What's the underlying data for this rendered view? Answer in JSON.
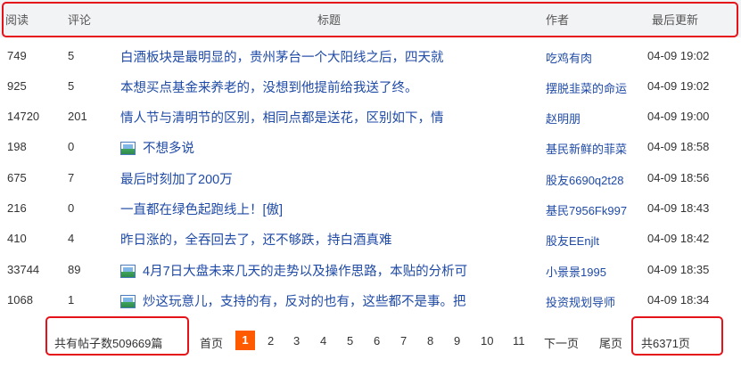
{
  "header": {
    "read": "阅读",
    "comment": "评论",
    "title": "标题",
    "author": "作者",
    "updated": "最后更新"
  },
  "rows": [
    {
      "read": "749",
      "comment": "5",
      "title": "白酒板块是最明显的，贵州茅台一个大阳线之后，四天就",
      "author": "吃鸡有肉",
      "time": "04-09 19:02",
      "has_image": false
    },
    {
      "read": "925",
      "comment": "5",
      "title": "本想买点基金来养老的，没想到他提前给我送了终。",
      "author": "摆脱韭菜的命运",
      "time": "04-09 19:02",
      "has_image": false
    },
    {
      "read": "14720",
      "comment": "201",
      "title": "情人节与清明节的区别，相同点都是送花，区别如下，情",
      "author": "赵明朋",
      "time": "04-09 19:00",
      "has_image": false
    },
    {
      "read": "198",
      "comment": "0",
      "title": "不想多说",
      "author": "基民新鲜的菲菜",
      "time": "04-09 18:58",
      "has_image": true
    },
    {
      "read": "675",
      "comment": "7",
      "title": "最后时刻加了200万",
      "author": "股友6690q2t28",
      "time": "04-09 18:56",
      "has_image": false
    },
    {
      "read": "216",
      "comment": "0",
      "title": "一直都在绿色起跑线上！[傲]",
      "author": "基民7956Fk997",
      "time": "04-09 18:43",
      "has_image": false
    },
    {
      "read": "410",
      "comment": "4",
      "title": "昨日涨的，全吞回去了，还不够跌，持白酒真难",
      "author": "股友EEnjlt",
      "time": "04-09 18:42",
      "has_image": false
    },
    {
      "read": "33744",
      "comment": "89",
      "title": "4月7日大盘未来几天的走势以及操作思路，本贴的分析可",
      "author": "小景景1995",
      "time": "04-09 18:35",
      "has_image": true
    },
    {
      "read": "1068",
      "comment": "1",
      "title": "炒这玩意儿，支持的有，反对的也有，这些都不是事。把",
      "author": "投资规划导师",
      "time": "04-09 18:34",
      "has_image": true
    }
  ],
  "footer": {
    "total_posts": "共有帖子数509669篇",
    "first": "首页",
    "pages": [
      "1",
      "2",
      "3",
      "4",
      "5",
      "6",
      "7",
      "8",
      "9",
      "10",
      "11"
    ],
    "current_page": "1",
    "next": "下一页",
    "last": "尾页",
    "total_pages": "共6371页"
  },
  "colors": {
    "header_bg": "#f2f3f5",
    "link": "#1f4aa6",
    "active_page": "#ff5a00",
    "highlight_box": "#e5121a"
  }
}
